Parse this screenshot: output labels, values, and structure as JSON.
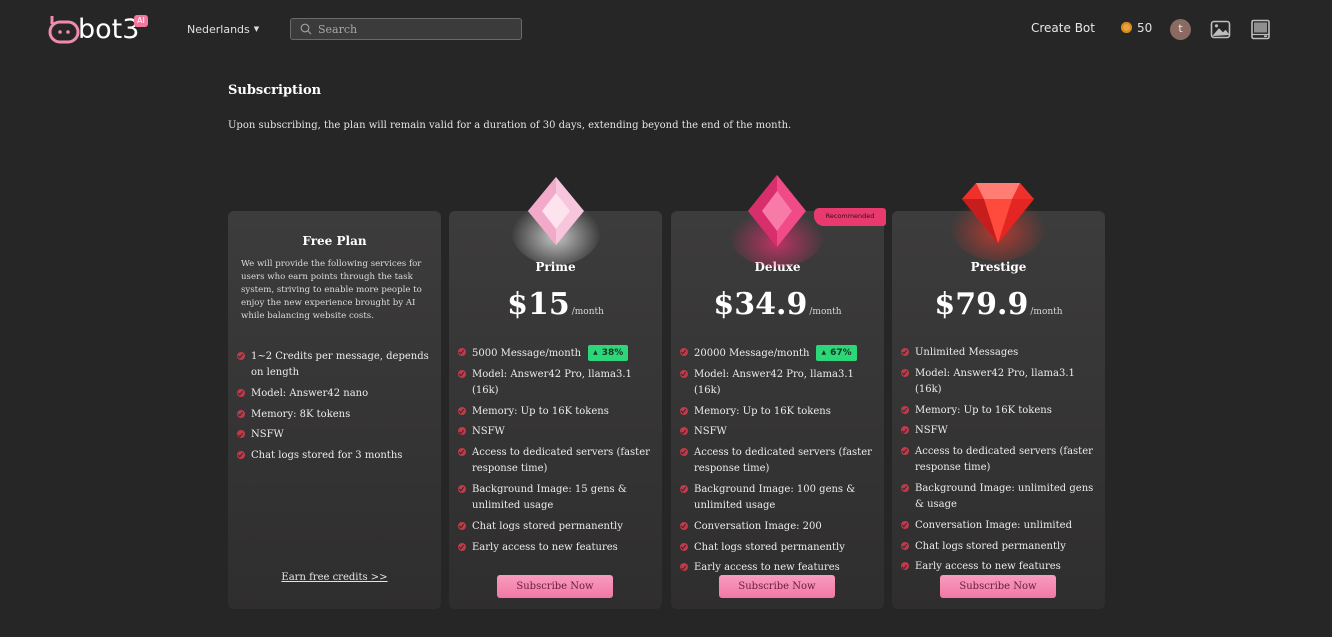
{
  "header": {
    "logo_text": "bot3",
    "logo_badge": "AI",
    "language": "Nederlands",
    "search_placeholder": "Search",
    "create_bot": "Create Bot",
    "credits": "50",
    "avatar_initial": "t"
  },
  "page": {
    "title": "Subscription",
    "subtitle": "Upon subscribing, the plan will remain valid for a duration of 30 days, extending beyond the end of the month."
  },
  "free_plan": {
    "title": "Free Plan",
    "description": "We will provide the following services for users who earn points through the task system, striving to enable more people to enjoy the new experience brought by AI while balancing website costs.",
    "features": [
      "1~2 Credits per message, depends on length",
      "Model: Answer42 nano",
      "Memory: 8K tokens",
      "NSFW",
      "Chat logs stored for 3 months"
    ],
    "link": "Earn free credits >>"
  },
  "plans": [
    {
      "name": "Prime",
      "price": "$15",
      "per": "/month",
      "first_feature": "5000 Message/month",
      "badge": "38%",
      "features": [
        "Model: Answer42 Pro, llama3.1 (16k)",
        "Memory: Up to 16K tokens",
        "NSFW",
        "Access to dedicated servers (faster response time)",
        "Background Image: 15 gens & unlimited usage",
        "Chat logs stored permanently",
        "Early access to new features"
      ],
      "button": "Subscribe Now"
    },
    {
      "name": "Deluxe",
      "price": "$34.9",
      "per": "/month",
      "recommended": "Recommended",
      "first_feature": "20000 Message/month",
      "badge": "67%",
      "features": [
        "Model: Answer42 Pro, llama3.1 (16k)",
        "Memory: Up to 16K tokens",
        "NSFW",
        "Access to dedicated servers (faster response time)",
        "Background Image: 100 gens & unlimited usage",
        "Conversation Image: 200",
        "Chat logs stored permanently",
        "Early access to new features"
      ],
      "button": "Subscribe Now"
    },
    {
      "name": "Prestige",
      "price": "$79.9",
      "per": "/month",
      "first_feature": "Unlimited Messages",
      "features": [
        "Model: Answer42 Pro, llama3.1 (16k)",
        "Memory: Up to 16K tokens",
        "NSFW",
        "Access to dedicated servers (faster response time)",
        "Background Image: unlimited gens & usage",
        "Conversation Image: unlimited",
        "Chat logs stored permanently",
        "Early access to new features"
      ],
      "button": "Subscribe Now"
    }
  ],
  "colors": {
    "background": "#272626",
    "accent_pink": "#f278a5",
    "badge_green": "#2ed67a",
    "check_red": "#c03a4a",
    "recommended": "#e83a6c"
  }
}
